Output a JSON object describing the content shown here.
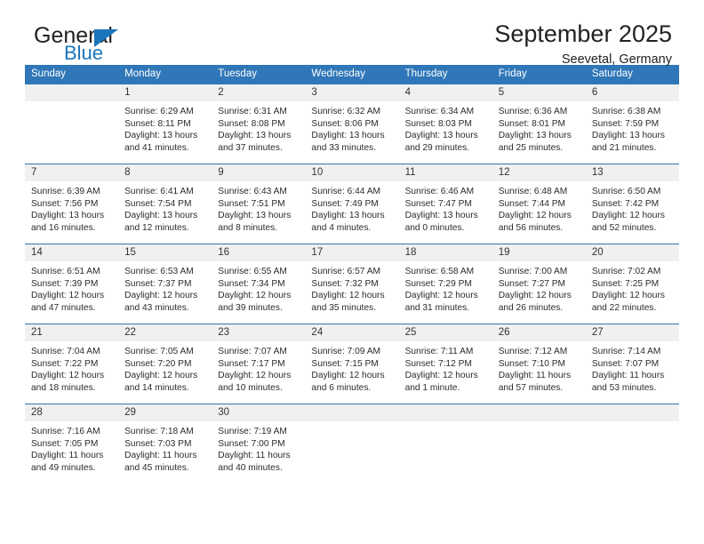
{
  "brand": {
    "word_one": "General",
    "word_two": "Blue",
    "flag_icon": "triangle-flag-icon",
    "accent_color": "#1b75bb"
  },
  "header": {
    "title": "September 2025",
    "location": "Seevetal, Germany"
  },
  "calendar": {
    "header_bg": "#2f77b8",
    "daynum_bg": "#f0f0f0",
    "day_names": [
      "Sunday",
      "Monday",
      "Tuesday",
      "Wednesday",
      "Thursday",
      "Friday",
      "Saturday"
    ],
    "weeks": [
      [
        {
          "day": "",
          "sunrise": "",
          "sunset": "",
          "daylight_1": "",
          "daylight_2": ""
        },
        {
          "day": "1",
          "sunrise": "Sunrise: 6:29 AM",
          "sunset": "Sunset: 8:11 PM",
          "daylight_1": "Daylight: 13 hours",
          "daylight_2": "and 41 minutes."
        },
        {
          "day": "2",
          "sunrise": "Sunrise: 6:31 AM",
          "sunset": "Sunset: 8:08 PM",
          "daylight_1": "Daylight: 13 hours",
          "daylight_2": "and 37 minutes."
        },
        {
          "day": "3",
          "sunrise": "Sunrise: 6:32 AM",
          "sunset": "Sunset: 8:06 PM",
          "daylight_1": "Daylight: 13 hours",
          "daylight_2": "and 33 minutes."
        },
        {
          "day": "4",
          "sunrise": "Sunrise: 6:34 AM",
          "sunset": "Sunset: 8:03 PM",
          "daylight_1": "Daylight: 13 hours",
          "daylight_2": "and 29 minutes."
        },
        {
          "day": "5",
          "sunrise": "Sunrise: 6:36 AM",
          "sunset": "Sunset: 8:01 PM",
          "daylight_1": "Daylight: 13 hours",
          "daylight_2": "and 25 minutes."
        },
        {
          "day": "6",
          "sunrise": "Sunrise: 6:38 AM",
          "sunset": "Sunset: 7:59 PM",
          "daylight_1": "Daylight: 13 hours",
          "daylight_2": "and 21 minutes."
        }
      ],
      [
        {
          "day": "7",
          "sunrise": "Sunrise: 6:39 AM",
          "sunset": "Sunset: 7:56 PM",
          "daylight_1": "Daylight: 13 hours",
          "daylight_2": "and 16 minutes."
        },
        {
          "day": "8",
          "sunrise": "Sunrise: 6:41 AM",
          "sunset": "Sunset: 7:54 PM",
          "daylight_1": "Daylight: 13 hours",
          "daylight_2": "and 12 minutes."
        },
        {
          "day": "9",
          "sunrise": "Sunrise: 6:43 AM",
          "sunset": "Sunset: 7:51 PM",
          "daylight_1": "Daylight: 13 hours",
          "daylight_2": "and 8 minutes."
        },
        {
          "day": "10",
          "sunrise": "Sunrise: 6:44 AM",
          "sunset": "Sunset: 7:49 PM",
          "daylight_1": "Daylight: 13 hours",
          "daylight_2": "and 4 minutes."
        },
        {
          "day": "11",
          "sunrise": "Sunrise: 6:46 AM",
          "sunset": "Sunset: 7:47 PM",
          "daylight_1": "Daylight: 13 hours",
          "daylight_2": "and 0 minutes."
        },
        {
          "day": "12",
          "sunrise": "Sunrise: 6:48 AM",
          "sunset": "Sunset: 7:44 PM",
          "daylight_1": "Daylight: 12 hours",
          "daylight_2": "and 56 minutes."
        },
        {
          "day": "13",
          "sunrise": "Sunrise: 6:50 AM",
          "sunset": "Sunset: 7:42 PM",
          "daylight_1": "Daylight: 12 hours",
          "daylight_2": "and 52 minutes."
        }
      ],
      [
        {
          "day": "14",
          "sunrise": "Sunrise: 6:51 AM",
          "sunset": "Sunset: 7:39 PM",
          "daylight_1": "Daylight: 12 hours",
          "daylight_2": "and 47 minutes."
        },
        {
          "day": "15",
          "sunrise": "Sunrise: 6:53 AM",
          "sunset": "Sunset: 7:37 PM",
          "daylight_1": "Daylight: 12 hours",
          "daylight_2": "and 43 minutes."
        },
        {
          "day": "16",
          "sunrise": "Sunrise: 6:55 AM",
          "sunset": "Sunset: 7:34 PM",
          "daylight_1": "Daylight: 12 hours",
          "daylight_2": "and 39 minutes."
        },
        {
          "day": "17",
          "sunrise": "Sunrise: 6:57 AM",
          "sunset": "Sunset: 7:32 PM",
          "daylight_1": "Daylight: 12 hours",
          "daylight_2": "and 35 minutes."
        },
        {
          "day": "18",
          "sunrise": "Sunrise: 6:58 AM",
          "sunset": "Sunset: 7:29 PM",
          "daylight_1": "Daylight: 12 hours",
          "daylight_2": "and 31 minutes."
        },
        {
          "day": "19",
          "sunrise": "Sunrise: 7:00 AM",
          "sunset": "Sunset: 7:27 PM",
          "daylight_1": "Daylight: 12 hours",
          "daylight_2": "and 26 minutes."
        },
        {
          "day": "20",
          "sunrise": "Sunrise: 7:02 AM",
          "sunset": "Sunset: 7:25 PM",
          "daylight_1": "Daylight: 12 hours",
          "daylight_2": "and 22 minutes."
        }
      ],
      [
        {
          "day": "21",
          "sunrise": "Sunrise: 7:04 AM",
          "sunset": "Sunset: 7:22 PM",
          "daylight_1": "Daylight: 12 hours",
          "daylight_2": "and 18 minutes."
        },
        {
          "day": "22",
          "sunrise": "Sunrise: 7:05 AM",
          "sunset": "Sunset: 7:20 PM",
          "daylight_1": "Daylight: 12 hours",
          "daylight_2": "and 14 minutes."
        },
        {
          "day": "23",
          "sunrise": "Sunrise: 7:07 AM",
          "sunset": "Sunset: 7:17 PM",
          "daylight_1": "Daylight: 12 hours",
          "daylight_2": "and 10 minutes."
        },
        {
          "day": "24",
          "sunrise": "Sunrise: 7:09 AM",
          "sunset": "Sunset: 7:15 PM",
          "daylight_1": "Daylight: 12 hours",
          "daylight_2": "and 6 minutes."
        },
        {
          "day": "25",
          "sunrise": "Sunrise: 7:11 AM",
          "sunset": "Sunset: 7:12 PM",
          "daylight_1": "Daylight: 12 hours",
          "daylight_2": "and 1 minute."
        },
        {
          "day": "26",
          "sunrise": "Sunrise: 7:12 AM",
          "sunset": "Sunset: 7:10 PM",
          "daylight_1": "Daylight: 11 hours",
          "daylight_2": "and 57 minutes."
        },
        {
          "day": "27",
          "sunrise": "Sunrise: 7:14 AM",
          "sunset": "Sunset: 7:07 PM",
          "daylight_1": "Daylight: 11 hours",
          "daylight_2": "and 53 minutes."
        }
      ],
      [
        {
          "day": "28",
          "sunrise": "Sunrise: 7:16 AM",
          "sunset": "Sunset: 7:05 PM",
          "daylight_1": "Daylight: 11 hours",
          "daylight_2": "and 49 minutes."
        },
        {
          "day": "29",
          "sunrise": "Sunrise: 7:18 AM",
          "sunset": "Sunset: 7:03 PM",
          "daylight_1": "Daylight: 11 hours",
          "daylight_2": "and 45 minutes."
        },
        {
          "day": "30",
          "sunrise": "Sunrise: 7:19 AM",
          "sunset": "Sunset: 7:00 PM",
          "daylight_1": "Daylight: 11 hours",
          "daylight_2": "and 40 minutes."
        },
        {
          "day": "",
          "sunrise": "",
          "sunset": "",
          "daylight_1": "",
          "daylight_2": ""
        },
        {
          "day": "",
          "sunrise": "",
          "sunset": "",
          "daylight_1": "",
          "daylight_2": ""
        },
        {
          "day": "",
          "sunrise": "",
          "sunset": "",
          "daylight_1": "",
          "daylight_2": ""
        },
        {
          "day": "",
          "sunrise": "",
          "sunset": "",
          "daylight_1": "",
          "daylight_2": ""
        }
      ]
    ]
  }
}
